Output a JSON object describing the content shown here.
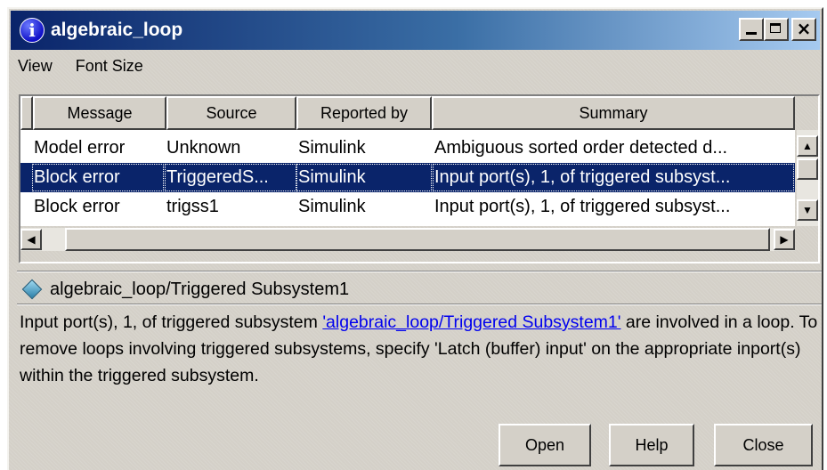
{
  "window": {
    "title": "algebraic_loop",
    "info_glyph": "i",
    "title_icon": "info-icon"
  },
  "menu": {
    "items": [
      "View",
      "Font Size"
    ]
  },
  "table": {
    "columns": [
      "Message",
      "Source",
      "Reported by",
      "Summary"
    ],
    "rows": [
      {
        "message": "Model error",
        "source": "Unknown",
        "reported_by": "Simulink",
        "summary": "Ambiguous sorted order detected d...",
        "selected": false
      },
      {
        "message": "Block error",
        "source": "TriggeredS...",
        "reported_by": "Simulink",
        "summary": "Input port(s), 1, of triggered subsyst...",
        "selected": true
      },
      {
        "message": "Block error",
        "source": "trigss1",
        "reported_by": "Simulink",
        "summary": "Input port(s), 1, of triggered subsyst...",
        "selected": false
      }
    ]
  },
  "detail": {
    "path": "algebraic_loop/Triggered Subsystem1",
    "path_icon": "subsystem-diamond-icon",
    "message_prefix": "Input port(s), 1, of triggered subsystem ",
    "message_link": "'algebraic_loop/Triggered Subsystem1'",
    "message_suffix": " are involved in a loop. To remove loops involving triggered subsystems, specify 'Latch (buffer) input' on the appropriate inport(s) within the triggered subsystem."
  },
  "buttons": {
    "open": "Open",
    "help": "Help",
    "close": "Close"
  },
  "colors": {
    "title_start": "#0a246a",
    "title_end": "#a6caf0",
    "selection": "#0a246a",
    "link": "#0000ee",
    "face": "#d4d0c8"
  }
}
